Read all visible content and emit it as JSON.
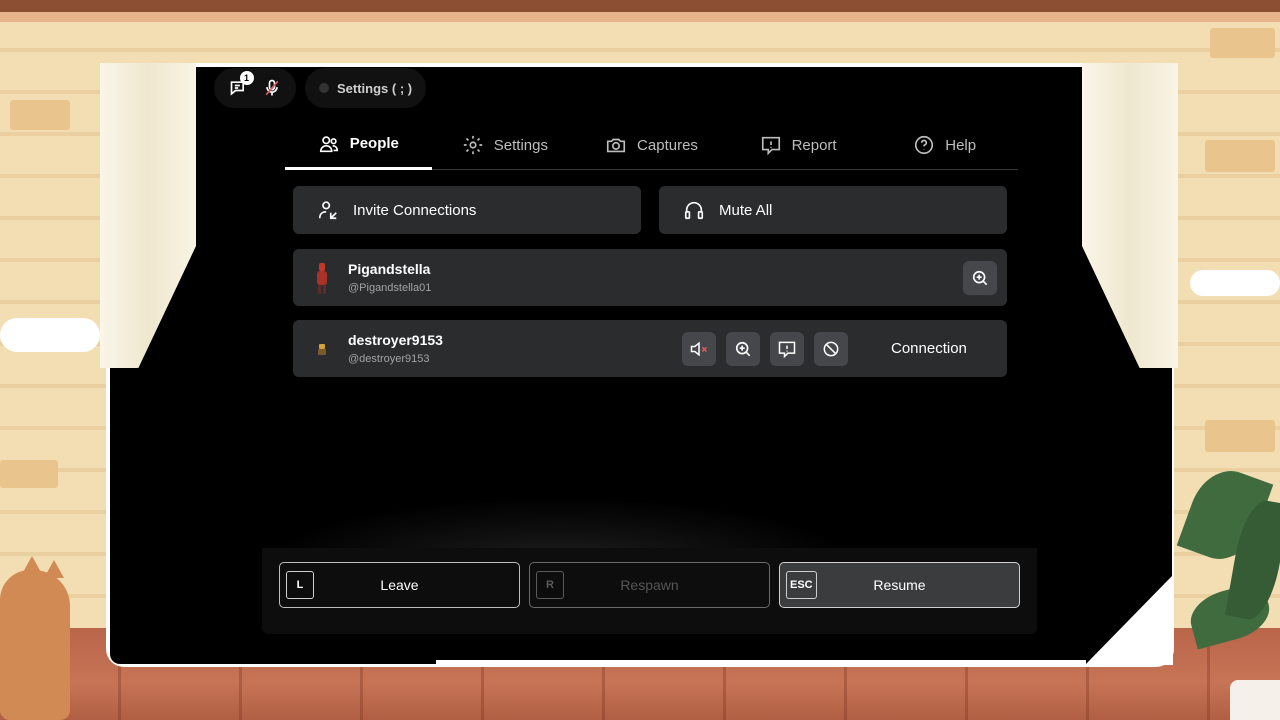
{
  "topbar": {
    "chat_badge": "1",
    "chat_icon": "chat-icon",
    "mic_icon": "mic-muted-icon",
    "settings_label": "Settings ( ; )"
  },
  "tabs": [
    {
      "label": "People",
      "icon": "people-icon",
      "active": true
    },
    {
      "label": "Settings",
      "icon": "gear-icon"
    },
    {
      "label": "Captures",
      "icon": "camera-icon"
    },
    {
      "label": "Report",
      "icon": "report-icon"
    },
    {
      "label": "Help",
      "icon": "help-icon"
    }
  ],
  "actions": {
    "invite_label": "Invite Connections",
    "mute_all_label": "Mute All"
  },
  "players": [
    {
      "name": "Pigandstella",
      "handle": "@Pigandstella01"
    },
    {
      "name": "destroyer9153",
      "handle": "@destroyer9153",
      "status": "Connection"
    }
  ],
  "bottom": {
    "leave": {
      "key": "L",
      "label": "Leave"
    },
    "respawn": {
      "key": "R",
      "label": "Respawn"
    },
    "resume": {
      "key": "ESC",
      "label": "Resume"
    }
  },
  "colors": {
    "panel": "#2b2c2e",
    "icon_button": "#45474a",
    "mute_red": "#e05a5a"
  }
}
